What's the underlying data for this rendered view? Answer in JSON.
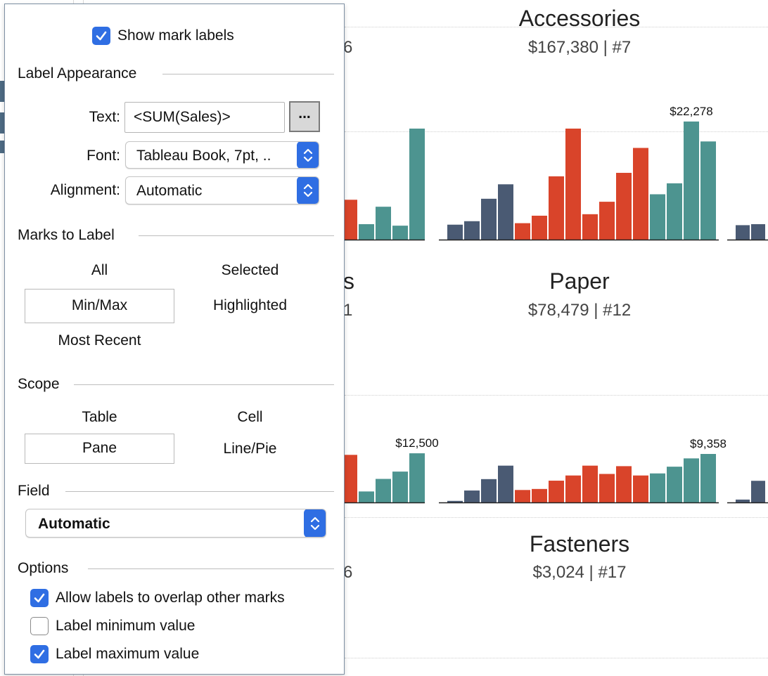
{
  "dialog": {
    "show_mark_labels": {
      "label": "Show mark labels",
      "checked": true
    },
    "label_appearance": {
      "heading": "Label Appearance",
      "text_label": "Text:",
      "text_value": "<SUM(Sales)>",
      "text_button": "...",
      "font_label": "Font:",
      "font_value": "Tableau Book, 7pt, ..",
      "alignment_label": "Alignment:",
      "alignment_value": "Automatic"
    },
    "marks_to_label": {
      "heading": "Marks to Label",
      "options": [
        "All",
        "Selected",
        "Min/Max",
        "Highlighted",
        "Most Recent"
      ],
      "selected": "Min/Max"
    },
    "scope": {
      "heading": "Scope",
      "options": [
        "Table",
        "Cell",
        "Pane",
        "Line/Pie"
      ],
      "selected": "Pane"
    },
    "field": {
      "heading": "Field",
      "value": "Automatic"
    },
    "options": {
      "heading": "Options",
      "items": [
        {
          "label": "Allow labels to overlap other marks",
          "checked": true
        },
        {
          "label": "Label minimum value",
          "checked": false
        },
        {
          "label": "Label maximum value",
          "checked": true
        }
      ]
    }
  },
  "dashboard": {
    "panes": [
      {
        "title": "Accessories",
        "subtitle": "$167,380 | #7"
      },
      {
        "title": "Paper",
        "subtitle": "$78,479 | #12"
      },
      {
        "title": "Fasteners",
        "subtitle": "$3,024 | #17"
      }
    ],
    "partial_texts": [
      "6",
      "s",
      "1",
      "6"
    ],
    "colors": {
      "navy": "#4a5a73",
      "orange": "#d9442a",
      "teal": "#4d9490",
      "dialog_accent": "#2f6ee3"
    }
  },
  "chart_data": [
    {
      "type": "bar",
      "title": "",
      "pane": "left-partial-row1",
      "values": [
        8000,
        3100,
        6600,
        2800,
        22278
      ],
      "colors": [
        "orange",
        "teal",
        "teal",
        "teal",
        "teal"
      ],
      "labels": []
    },
    {
      "type": "bar",
      "pane": "Accessories",
      "values": [
        3000,
        3700,
        8200,
        11100,
        3300,
        4800,
        12700,
        22278,
        5100,
        7600,
        13400,
        18400,
        9100,
        11300,
        23700,
        19700
      ],
      "colors": [
        "navy",
        "navy",
        "navy",
        "navy",
        "orange",
        "orange",
        "orange",
        "orange",
        "orange",
        "orange",
        "orange",
        "orange",
        "teal",
        "teal",
        "teal",
        "teal"
      ],
      "max_label": "$22,278"
    },
    {
      "type": "bar",
      "pane": "right-partial-row1",
      "values": [
        2900,
        3100
      ],
      "colors": [
        "navy",
        "navy"
      ]
    },
    {
      "type": "bar",
      "pane": "left-partial-row2",
      "values": [
        9100,
        2100,
        4500,
        5900,
        9400
      ],
      "colors": [
        "orange",
        "teal",
        "teal",
        "teal",
        "teal"
      ],
      "max_label": "$12,500"
    },
    {
      "type": "bar",
      "pane": "Paper",
      "values": [
        300,
        2300,
        4500,
        7100,
        2400,
        2600,
        4200,
        5200,
        7100,
        5500,
        7000,
        5200,
        5600,
        6900,
        8500,
        9358
      ],
      "colors": [
        "navy",
        "navy",
        "navy",
        "navy",
        "orange",
        "orange",
        "orange",
        "orange",
        "orange",
        "orange",
        "orange",
        "orange",
        "teal",
        "teal",
        "teal",
        "teal"
      ],
      "max_label": "$9,358"
    },
    {
      "type": "bar",
      "pane": "right-partial-row2",
      "values": [
        500,
        3800
      ],
      "colors": [
        "navy",
        "navy"
      ]
    }
  ]
}
